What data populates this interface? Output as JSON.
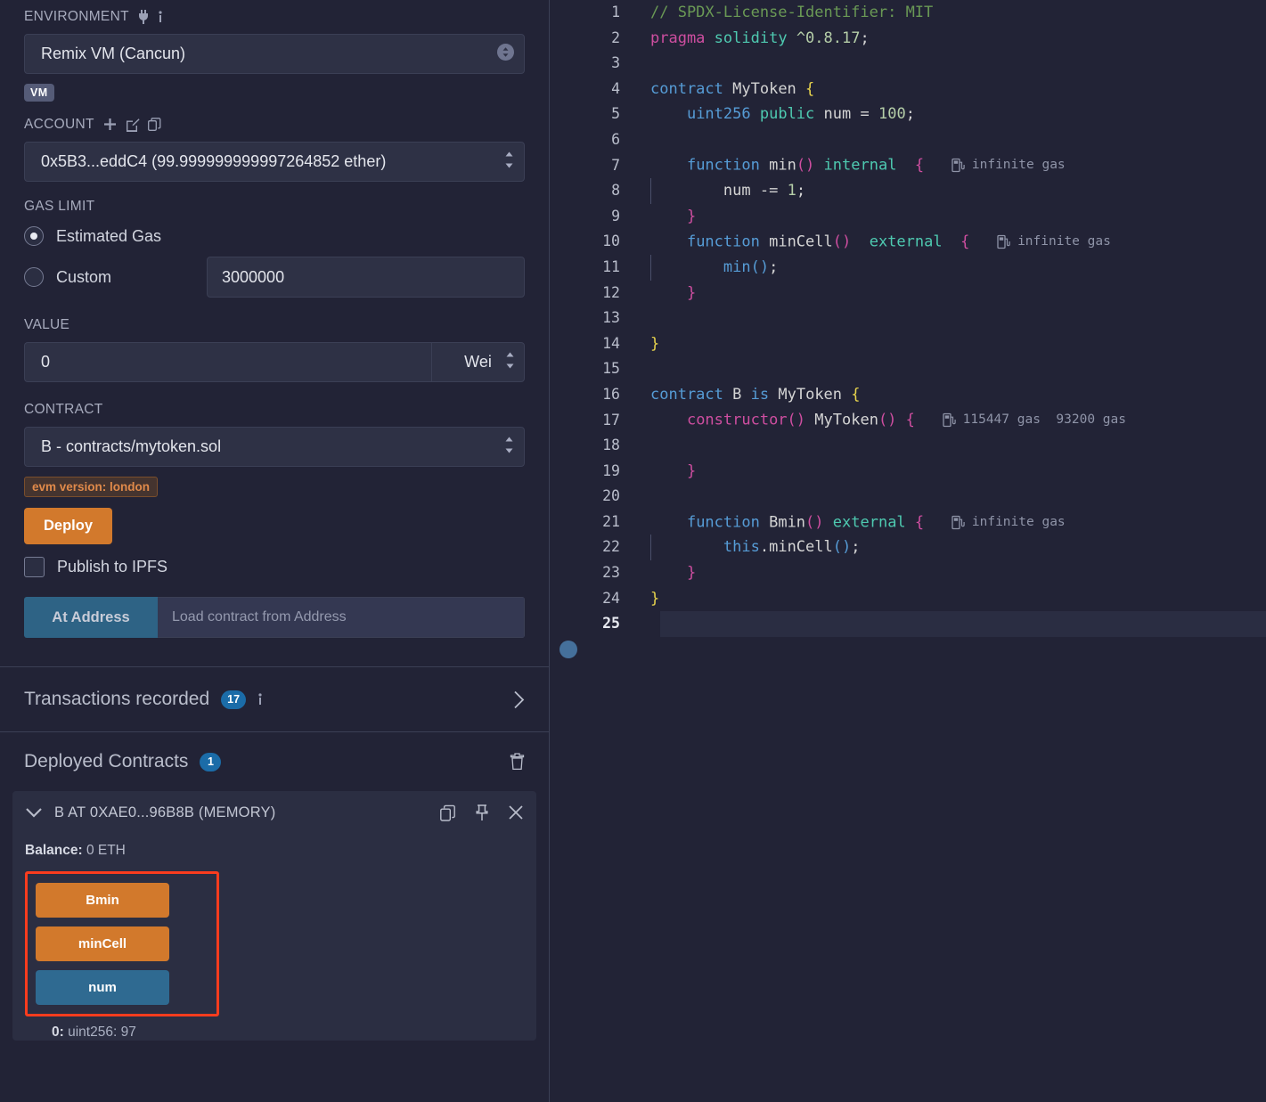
{
  "sidebar": {
    "environment": {
      "label": "ENVIRONMENT",
      "value": "Remix VM (Cancun)",
      "badge": "VM",
      "plug_icon": "plug-icon",
      "info_icon": "info-icon"
    },
    "account": {
      "label": "ACCOUNT",
      "value": "0x5B3...eddC4 (99.999999999997264852 ether)",
      "add_icon": "plus-icon",
      "edit_icon": "edit-icon",
      "copy_icon": "copy-icon"
    },
    "gas_limit": {
      "label": "GAS LIMIT",
      "estimated_label": "Estimated Gas",
      "custom_label": "Custom",
      "selected": "Estimated Gas",
      "custom_value": "3000000"
    },
    "value": {
      "label": "VALUE",
      "amount": "0",
      "unit": "Wei"
    },
    "contract": {
      "label": "CONTRACT",
      "value": "B - contracts/mytoken.sol",
      "evm_badge": "evm version: london",
      "deploy_label": "Deploy",
      "publish_label": "Publish to IPFS",
      "at_address_label": "At Address",
      "at_address_placeholder": "Load contract from Address"
    },
    "transactions": {
      "title": "Transactions recorded",
      "count": "17",
      "info_icon": "info-icon",
      "chevron_icon": "chevron-right-icon"
    },
    "deployed": {
      "title": "Deployed Contracts",
      "count": "1",
      "trash_icon": "trash-icon",
      "card": {
        "title": "B AT 0XAE0...96B8B (MEMORY)",
        "chevron_icon": "chevron-down-icon",
        "copy_icon": "copy-icon",
        "pin_icon": "pin-icon",
        "close_icon": "close-icon",
        "balance_label": "Balance:",
        "balance_value": "0 ETH",
        "functions": [
          {
            "label": "Bmin",
            "kind": "transact"
          },
          {
            "label": "minCell",
            "kind": "transact"
          },
          {
            "label": "num",
            "kind": "call"
          }
        ],
        "return_index": "0:",
        "return_value": "uint256: 97"
      }
    }
  },
  "editor": {
    "gas_icon": "gas-pump-icon",
    "breakpoint_line": "25",
    "lines": [
      {
        "n": "1",
        "tokens": [
          {
            "t": "// SPDX-License-Identifier: MIT",
            "c": "c-com"
          }
        ]
      },
      {
        "n": "2",
        "tokens": [
          {
            "t": "pragma",
            "c": "c-kw"
          },
          {
            "t": " ",
            "c": "c-op"
          },
          {
            "t": "solidity",
            "c": "c-green"
          },
          {
            "t": " ",
            "c": "c-op"
          },
          {
            "t": "^0.8.17",
            "c": "c-num"
          },
          {
            "t": ";",
            "c": "c-op"
          }
        ]
      },
      {
        "n": "3",
        "tokens": []
      },
      {
        "n": "4",
        "tokens": [
          {
            "t": "contract",
            "c": "c-kw2"
          },
          {
            "t": " ",
            "c": "c-op"
          },
          {
            "t": "MyToken",
            "c": "c-id"
          },
          {
            "t": " ",
            "c": "c-op"
          },
          {
            "t": "{",
            "c": "c-brace-y"
          }
        ]
      },
      {
        "n": "5",
        "tokens": [
          {
            "t": "    ",
            "c": "c-op"
          },
          {
            "t": "uint256",
            "c": "c-kw2"
          },
          {
            "t": " ",
            "c": "c-op"
          },
          {
            "t": "public",
            "c": "c-typ"
          },
          {
            "t": " ",
            "c": "c-op"
          },
          {
            "t": "num",
            "c": "c-id"
          },
          {
            "t": " = ",
            "c": "c-op"
          },
          {
            "t": "100",
            "c": "c-num"
          },
          {
            "t": ";",
            "c": "c-op"
          }
        ]
      },
      {
        "n": "6",
        "tokens": []
      },
      {
        "n": "7",
        "tokens": [
          {
            "t": "    ",
            "c": "c-op"
          },
          {
            "t": "function",
            "c": "c-kw2"
          },
          {
            "t": " ",
            "c": "c-op"
          },
          {
            "t": "min",
            "c": "c-id"
          },
          {
            "t": "()",
            "c": "c-brace-p"
          },
          {
            "t": " ",
            "c": "c-op"
          },
          {
            "t": "internal",
            "c": "c-typ"
          },
          {
            "t": "  ",
            "c": "c-op"
          },
          {
            "t": "{",
            "c": "c-brace-p"
          }
        ],
        "gas": "infinite gas"
      },
      {
        "n": "8",
        "tokens": [
          {
            "t": "        ",
            "c": "c-op"
          },
          {
            "t": "num",
            "c": "c-id"
          },
          {
            "t": " -= ",
            "c": "c-op"
          },
          {
            "t": "1",
            "c": "c-num"
          },
          {
            "t": ";",
            "c": "c-op"
          }
        ],
        "guide": true
      },
      {
        "n": "9",
        "tokens": [
          {
            "t": "    ",
            "c": "c-op"
          },
          {
            "t": "}",
            "c": "c-brace-p"
          }
        ]
      },
      {
        "n": "10",
        "tokens": [
          {
            "t": "    ",
            "c": "c-op"
          },
          {
            "t": "function",
            "c": "c-kw2"
          },
          {
            "t": " ",
            "c": "c-op"
          },
          {
            "t": "minCell",
            "c": "c-id"
          },
          {
            "t": "()",
            "c": "c-brace-p"
          },
          {
            "t": "  ",
            "c": "c-op"
          },
          {
            "t": "external",
            "c": "c-typ"
          },
          {
            "t": "  ",
            "c": "c-op"
          },
          {
            "t": "{",
            "c": "c-brace-p"
          }
        ],
        "gas": "infinite gas"
      },
      {
        "n": "11",
        "tokens": [
          {
            "t": "        ",
            "c": "c-op"
          },
          {
            "t": "min",
            "c": "c-kw2"
          },
          {
            "t": "()",
            "c": "c-brace-b"
          },
          {
            "t": ";",
            "c": "c-op"
          }
        ],
        "guide": true
      },
      {
        "n": "12",
        "tokens": [
          {
            "t": "    ",
            "c": "c-op"
          },
          {
            "t": "}",
            "c": "c-brace-p"
          }
        ]
      },
      {
        "n": "13",
        "tokens": []
      },
      {
        "n": "14",
        "tokens": [
          {
            "t": "}",
            "c": "c-brace-y"
          }
        ]
      },
      {
        "n": "15",
        "tokens": []
      },
      {
        "n": "16",
        "tokens": [
          {
            "t": "contract",
            "c": "c-kw2"
          },
          {
            "t": " ",
            "c": "c-op"
          },
          {
            "t": "B",
            "c": "c-id"
          },
          {
            "t": " ",
            "c": "c-op"
          },
          {
            "t": "is",
            "c": "c-kw2"
          },
          {
            "t": " ",
            "c": "c-op"
          },
          {
            "t": "MyToken",
            "c": "c-id"
          },
          {
            "t": " ",
            "c": "c-op"
          },
          {
            "t": "{",
            "c": "c-brace-y"
          }
        ]
      },
      {
        "n": "17",
        "tokens": [
          {
            "t": "    ",
            "c": "c-op"
          },
          {
            "t": "constructor",
            "c": "c-brace-p"
          },
          {
            "t": "()",
            "c": "c-brace-p"
          },
          {
            "t": " ",
            "c": "c-op"
          },
          {
            "t": "MyToken",
            "c": "c-id"
          },
          {
            "t": "()",
            "c": "c-brace-p"
          },
          {
            "t": " ",
            "c": "c-op"
          },
          {
            "t": "{",
            "c": "c-brace-p"
          }
        ],
        "gas": "115447 gas  93200 gas"
      },
      {
        "n": "18",
        "tokens": []
      },
      {
        "n": "19",
        "tokens": [
          {
            "t": "    ",
            "c": "c-op"
          },
          {
            "t": "}",
            "c": "c-brace-p"
          }
        ]
      },
      {
        "n": "20",
        "tokens": []
      },
      {
        "n": "21",
        "tokens": [
          {
            "t": "    ",
            "c": "c-op"
          },
          {
            "t": "function",
            "c": "c-kw2"
          },
          {
            "t": " ",
            "c": "c-op"
          },
          {
            "t": "Bmin",
            "c": "c-id"
          },
          {
            "t": "()",
            "c": "c-brace-p"
          },
          {
            "t": " ",
            "c": "c-op"
          },
          {
            "t": "external",
            "c": "c-typ"
          },
          {
            "t": " ",
            "c": "c-op"
          },
          {
            "t": "{",
            "c": "c-brace-p"
          }
        ],
        "gas": "infinite gas"
      },
      {
        "n": "22",
        "tokens": [
          {
            "t": "        ",
            "c": "c-op"
          },
          {
            "t": "this",
            "c": "c-kw2"
          },
          {
            "t": ".",
            "c": "c-op"
          },
          {
            "t": "minCell",
            "c": "c-id"
          },
          {
            "t": "()",
            "c": "c-brace-b"
          },
          {
            "t": ";",
            "c": "c-op"
          }
        ],
        "guide": true
      },
      {
        "n": "23",
        "tokens": [
          {
            "t": "    ",
            "c": "c-op"
          },
          {
            "t": "}",
            "c": "c-brace-p"
          }
        ]
      },
      {
        "n": "24",
        "tokens": [
          {
            "t": "}",
            "c": "c-brace-y"
          }
        ]
      },
      {
        "n": "25",
        "tokens": [],
        "highlight": true
      }
    ]
  },
  "colors": {
    "accent_orange": "#d2792c",
    "accent_blue": "#2f6a91",
    "badge_blue": "#1b6ca8",
    "highlight_red": "#fa3c1e",
    "panel_bg": "#222336"
  }
}
